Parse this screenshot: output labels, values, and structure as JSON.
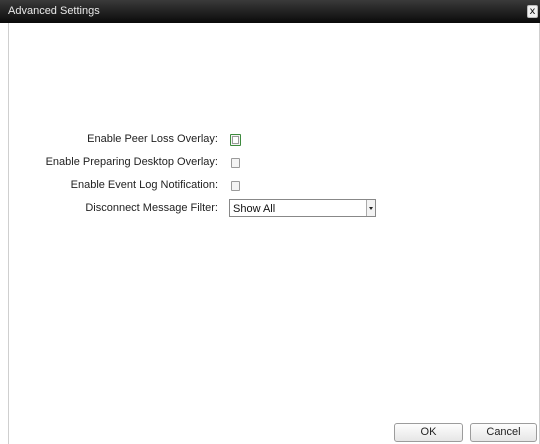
{
  "window": {
    "title": "Advanced Settings",
    "close_glyph": "x"
  },
  "form": {
    "peer_loss": {
      "label": "Enable Peer Loss Overlay:",
      "checked": false,
      "focused": true
    },
    "preparing_desktop": {
      "label": "Enable Preparing Desktop Overlay:",
      "checked": false
    },
    "event_log": {
      "label": "Enable Event Log Notification:",
      "checked": false
    },
    "disconnect_filter": {
      "label": "Disconnect Message Filter:",
      "value": "Show All"
    }
  },
  "buttons": {
    "ok_label": "OK",
    "cancel_label": "Cancel"
  },
  "icons": {
    "close": "close-icon",
    "dropdown": "chevron-down-icon"
  }
}
